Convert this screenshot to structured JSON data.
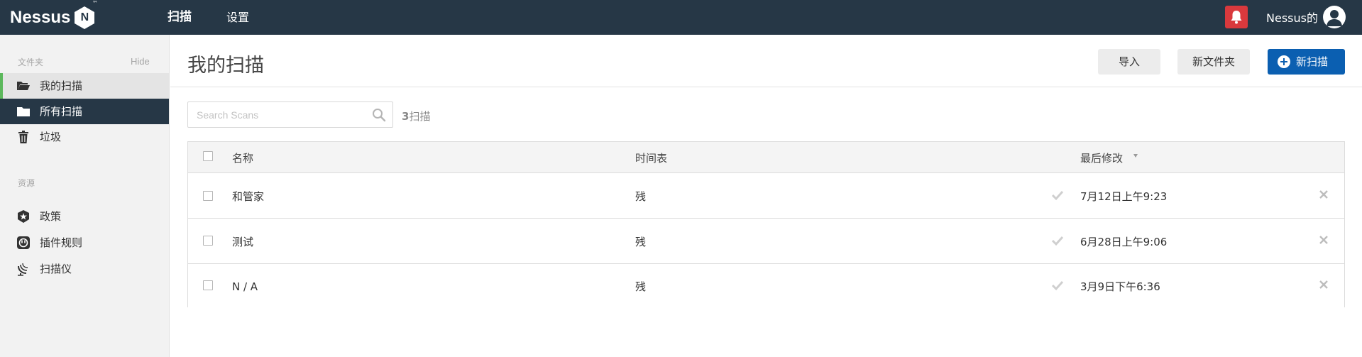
{
  "app": {
    "logo_text": "Nessus",
    "logo_badge": "N",
    "logo_tm": "™"
  },
  "topnav": {
    "scans_label": "扫描",
    "settings_label": "设置",
    "user_label": "Nessus的",
    "bell_color": "#d9393d"
  },
  "sidebar": {
    "folders_heading": "文件夹",
    "hide_label": "Hide",
    "items": [
      {
        "label": "我的扫描",
        "icon": "folder-open-icon"
      },
      {
        "label": "所有扫描",
        "icon": "folder-icon"
      },
      {
        "label": "垃圾",
        "icon": "trash-icon"
      }
    ],
    "resources_heading": "资源",
    "resources": [
      {
        "label": "政策",
        "icon": "shield-star-icon"
      },
      {
        "label": "插件规则",
        "icon": "plug-rule-icon"
      },
      {
        "label": "扫描仪",
        "icon": "radar-dish-icon"
      }
    ]
  },
  "main": {
    "title": "我的扫描",
    "import_label": "导入",
    "new_folder_label": "新文件夹",
    "new_scan_label": "新扫描",
    "accent_color": "#0b5fb1",
    "search_placeholder": "Search Scans",
    "search_value": "",
    "count_number": "3",
    "count_label": "扫描"
  },
  "table": {
    "headers": {
      "name": "名称",
      "schedule": "时间表",
      "last_modified": "最后修改"
    },
    "rows": [
      {
        "name": "和管家",
        "schedule": "残",
        "modified": "7月12日上午9:23"
      },
      {
        "name": "测试",
        "schedule": "残",
        "modified": "6月28日上午9:06"
      },
      {
        "name": "N / A",
        "schedule": "残",
        "modified": "3月9日下午6:36"
      }
    ]
  }
}
